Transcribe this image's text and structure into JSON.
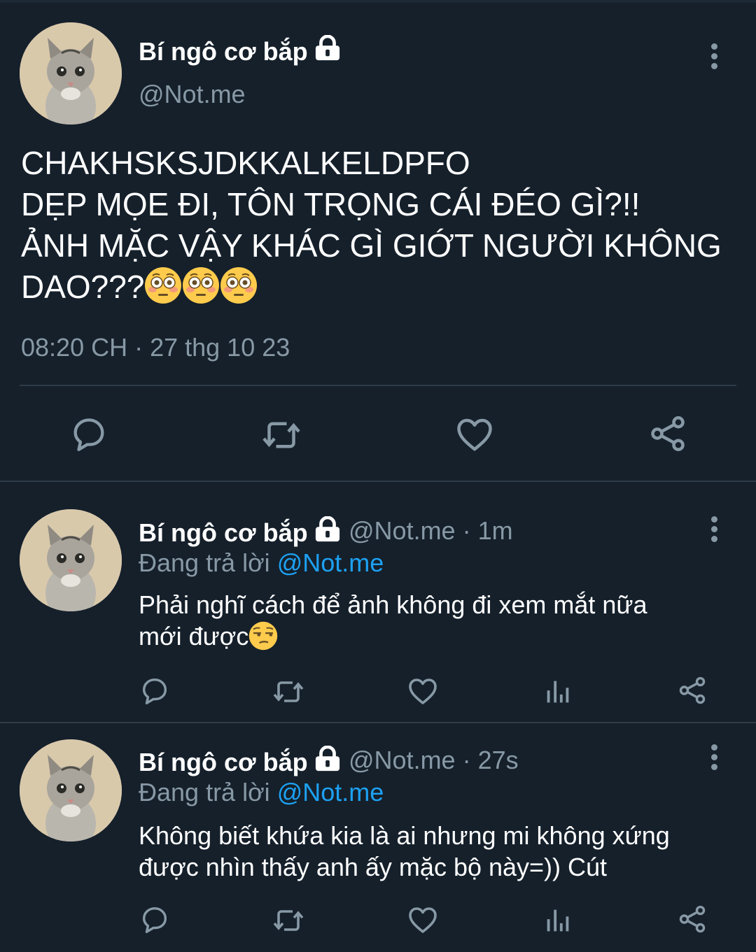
{
  "colors": {
    "background": "#15202b",
    "secondary_text": "#8899a6",
    "link": "#1da1f2",
    "divider": "#2f3b47"
  },
  "main_tweet": {
    "author_name": "Bí ngô cơ bắp",
    "handle": "@Not.me",
    "text_line1": "CHAKHSKSJDKKALKELDPFO",
    "text_line2": "DẸP MỌE ĐI, TÔN TRỌNG CÁI ĐÉO GÌ?!!",
    "text_line3": "ẢNH MẶC VẬY KHÁC GÌ GIỚT NGƯỜI KHÔNG",
    "text_line4": "DAO???",
    "emojis": [
      "flushed-face",
      "flushed-face",
      "flushed-face"
    ],
    "timestamp": "08:20 CH · 27 thg 10 23",
    "actions": [
      "reply-icon",
      "retweet-icon",
      "like-icon",
      "share-icon"
    ]
  },
  "replies": [
    {
      "author_name": "Bí ngô cơ bắp",
      "handle_time": "@Not.me · 1m",
      "replying_prefix": "Đang trả lời",
      "replying_to": "@Not.me",
      "text_line1": "Phải nghĩ cách để ảnh không đi xem mắt nữa",
      "text_line2": "mới được",
      "emoji": "unamused-face",
      "actions": [
        "reply-icon",
        "retweet-icon",
        "like-icon",
        "analytics-icon",
        "share-icon"
      ]
    },
    {
      "author_name": "Bí ngô cơ bắp",
      "handle_time": "@Not.me · 27s",
      "replying_prefix": "Đang trả lời",
      "replying_to": "@Not.me",
      "text_line1": "Không biết khứa kia là ai nhưng mi không xứng",
      "text_line2": "được nhìn thấy anh ấy mặc bộ này=)) Cút",
      "actions": [
        "reply-icon",
        "retweet-icon",
        "like-icon",
        "analytics-icon",
        "share-icon"
      ]
    }
  ]
}
